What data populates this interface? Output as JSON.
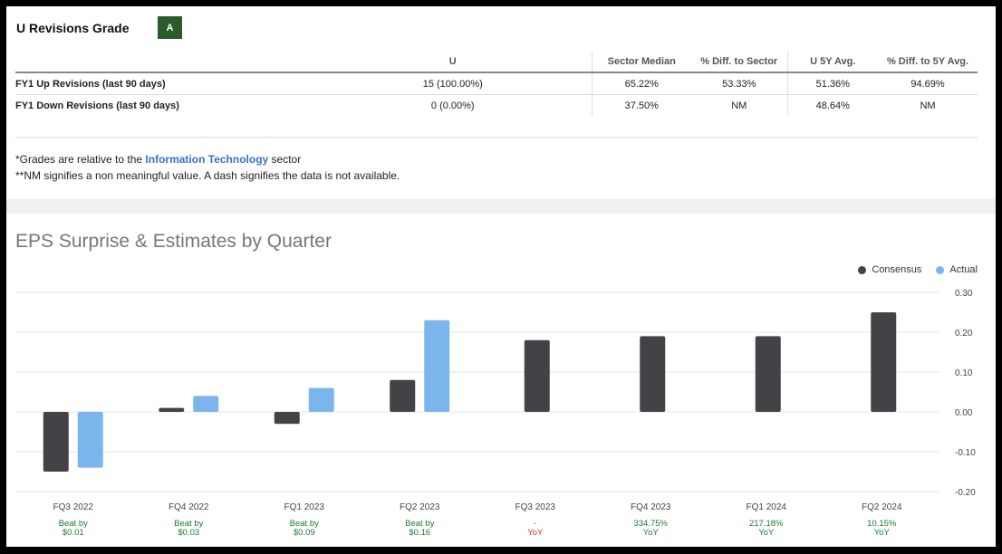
{
  "revisions": {
    "title": "U Revisions Grade",
    "grade": "A",
    "grade_color": "#2b5a2b",
    "columns": [
      "",
      "U",
      "Sector Median",
      "% Diff. to Sector",
      "U 5Y Avg.",
      "% Diff. to 5Y Avg."
    ],
    "rows": [
      [
        "FY1 Up Revisions (last 90 days)",
        "15 (100.00%)",
        "65.22%",
        "53.33%",
        "51.36%",
        "94.69%"
      ],
      [
        "FY1 Down Revisions (last 90 days)",
        "0 (0.00%)",
        "37.50%",
        "NM",
        "48.64%",
        "NM"
      ]
    ]
  },
  "notes": {
    "line1_prefix": "*Grades are relative to the ",
    "line1_link": "Information Technology",
    "line1_suffix": " sector",
    "line2": "**NM signifies a non meaningful value. A dash signifies the data is not available."
  },
  "chart_data": {
    "type": "bar",
    "title": "EPS Surprise & Estimates by Quarter",
    "categories": [
      "FQ3 2022",
      "FQ4 2022",
      "FQ1 2023",
      "FQ2 2023",
      "FQ3 2023",
      "FQ4 2023",
      "FQ1 2024",
      "FQ2 2024"
    ],
    "series": [
      {
        "name": "Consensus",
        "color": "#434247",
        "values": [
          -0.15,
          0.01,
          -0.03,
          0.08,
          0.18,
          0.19,
          0.19,
          0.25
        ]
      },
      {
        "name": "Actual",
        "color": "#7cb5ec",
        "values": [
          -0.14,
          0.04,
          0.06,
          0.23,
          null,
          null,
          null,
          null
        ]
      }
    ],
    "annotations": [
      {
        "line1": "Beat by",
        "line2": "$0.01",
        "color": "#1a7a3a"
      },
      {
        "line1": "Beat by",
        "line2": "$0.03",
        "color": "#1a7a3a"
      },
      {
        "line1": "Beat by",
        "line2": "$0.09",
        "color": "#1a7a3a"
      },
      {
        "line1": "Beat by",
        "line2": "$0.16",
        "color": "#1a7a3a"
      },
      {
        "line1": "-",
        "line2": "YoY",
        "color": "#d03030"
      },
      {
        "line1": "334.75%",
        "line2": "YoY",
        "color": "#1a7a3a"
      },
      {
        "line1": "217.18%",
        "line2": "YoY",
        "color": "#1a7a3a"
      },
      {
        "line1": "10.15%",
        "line2": "YoY",
        "color": "#1a7a3a"
      }
    ],
    "yticks": [
      0.3,
      0.2,
      0.1,
      0.0,
      -0.1,
      -0.2
    ],
    "ytick_labels": [
      "0.30",
      "0.20",
      "0.10",
      "0.00",
      "-0.10",
      "-0.20"
    ],
    "ylim": [
      -0.2,
      0.3
    ],
    "xlabel": "",
    "ylabel": "",
    "grid": true,
    "legend_position": "top-right"
  }
}
